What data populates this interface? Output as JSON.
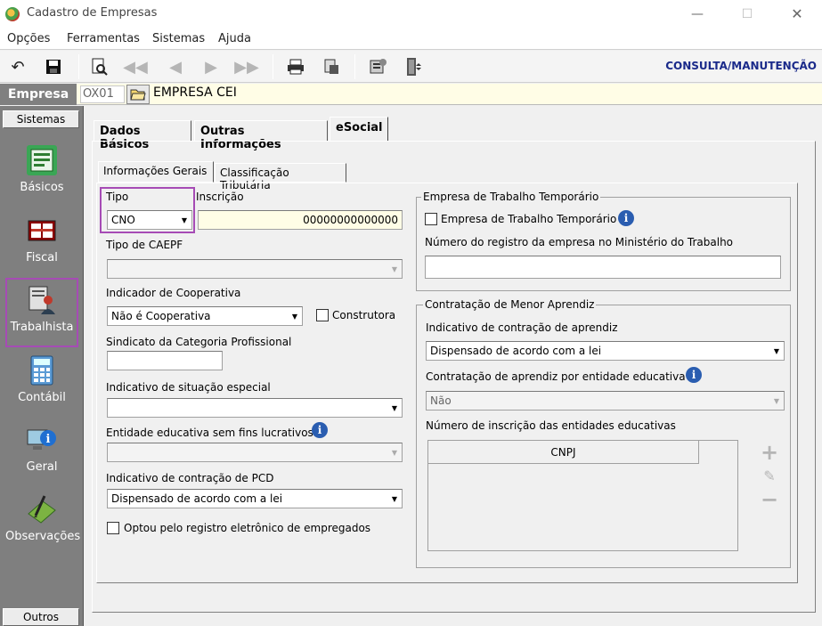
{
  "window": {
    "title": "Cadastro de Empresas"
  },
  "menu": [
    "Opções",
    "Ferramentas",
    "Sistemas",
    "Ajuda"
  ],
  "toolbar": {
    "mode_label": "CONSULTA/MANUTENÇÃO",
    "icons": [
      "undo-icon",
      "save-icon",
      "preview-icon",
      "first-record-icon",
      "previous-record-icon",
      "next-record-icon",
      "last-record-icon",
      "print-icon",
      "report-icon",
      "tools-icon",
      "exit-icon"
    ]
  },
  "empresa": {
    "label": "Empresa",
    "code": "OX01",
    "name": "EMPRESA CEI"
  },
  "sidebar": {
    "header_top": "Sistemas",
    "header_bottom": "Outros",
    "items": [
      {
        "label": "Básicos",
        "icon": "basicos-icon"
      },
      {
        "label": "Fiscal",
        "icon": "fiscal-icon"
      },
      {
        "label": "Trabalhista",
        "icon": "trabalhista-icon",
        "selected": true
      },
      {
        "label": "Contábil",
        "icon": "calculator-icon"
      },
      {
        "label": "Geral",
        "icon": "info-computer-icon"
      },
      {
        "label": "Observações",
        "icon": "notes-icon"
      }
    ]
  },
  "tabs": [
    "Dados Básicos",
    "Outras Informações",
    "eSocial"
  ],
  "subtabs": [
    "Informações Gerais",
    "Classificação Tributária"
  ],
  "form": {
    "tipo_label": "Tipo",
    "tipo_value": "CNO",
    "inscricao_label": "Inscrição",
    "inscricao_value": "00000000000000",
    "tipo_caepf_label": "Tipo de CAEPF",
    "tipo_caepf_value": "",
    "cooperativa_label": "Indicador de Cooperativa",
    "cooperativa_value": "Não é Cooperativa",
    "construtora_label": "Construtora",
    "sindicato_label": "Sindicato da Categoria Profissional",
    "sindicato_value": "",
    "situacao_label": "Indicativo de situação especial",
    "situacao_value": "",
    "entidade_label": "Entidade educativa sem fins lucrativos",
    "entidade_value": "",
    "pcd_label": "Indicativo de contração de PCD",
    "pcd_value": "Dispensado de acordo com a lei",
    "registro_eletronico_label": "Optou pelo registro eletrônico de empregados"
  },
  "trabalho_temporario": {
    "group_title": "Empresa de Trabalho Temporário",
    "checkbox_label": "Empresa de Trabalho Temporário",
    "registro_label": "Número do registro da empresa no Ministério do Trabalho",
    "registro_value": ""
  },
  "menor_aprendiz": {
    "group_title": "Contratação de Menor Aprendiz",
    "indicativo_label": "Indicativo de contração de aprendiz",
    "indicativo_value": "Dispensado de acordo com a lei",
    "entidade_label": "Contratação de aprendiz por entidade educativa",
    "entidade_value": "Não",
    "inscricoes_label": "Número de inscrição das entidades educativas",
    "table_header": "CNPJ"
  },
  "highlight_color": "#a64bb5"
}
